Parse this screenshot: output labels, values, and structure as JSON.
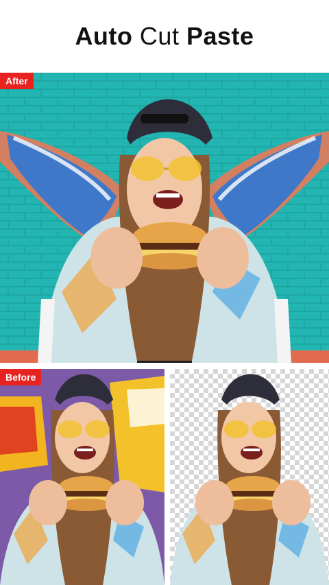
{
  "header": {
    "title_part1": "Auto",
    "title_part2": "Cut",
    "title_part3": "Paste"
  },
  "panels": {
    "after_label": "After",
    "before_label": "Before"
  },
  "colors": {
    "badge": "#e8231f",
    "after_background": "#23b7b3",
    "before_background": "#7c5aa8"
  }
}
